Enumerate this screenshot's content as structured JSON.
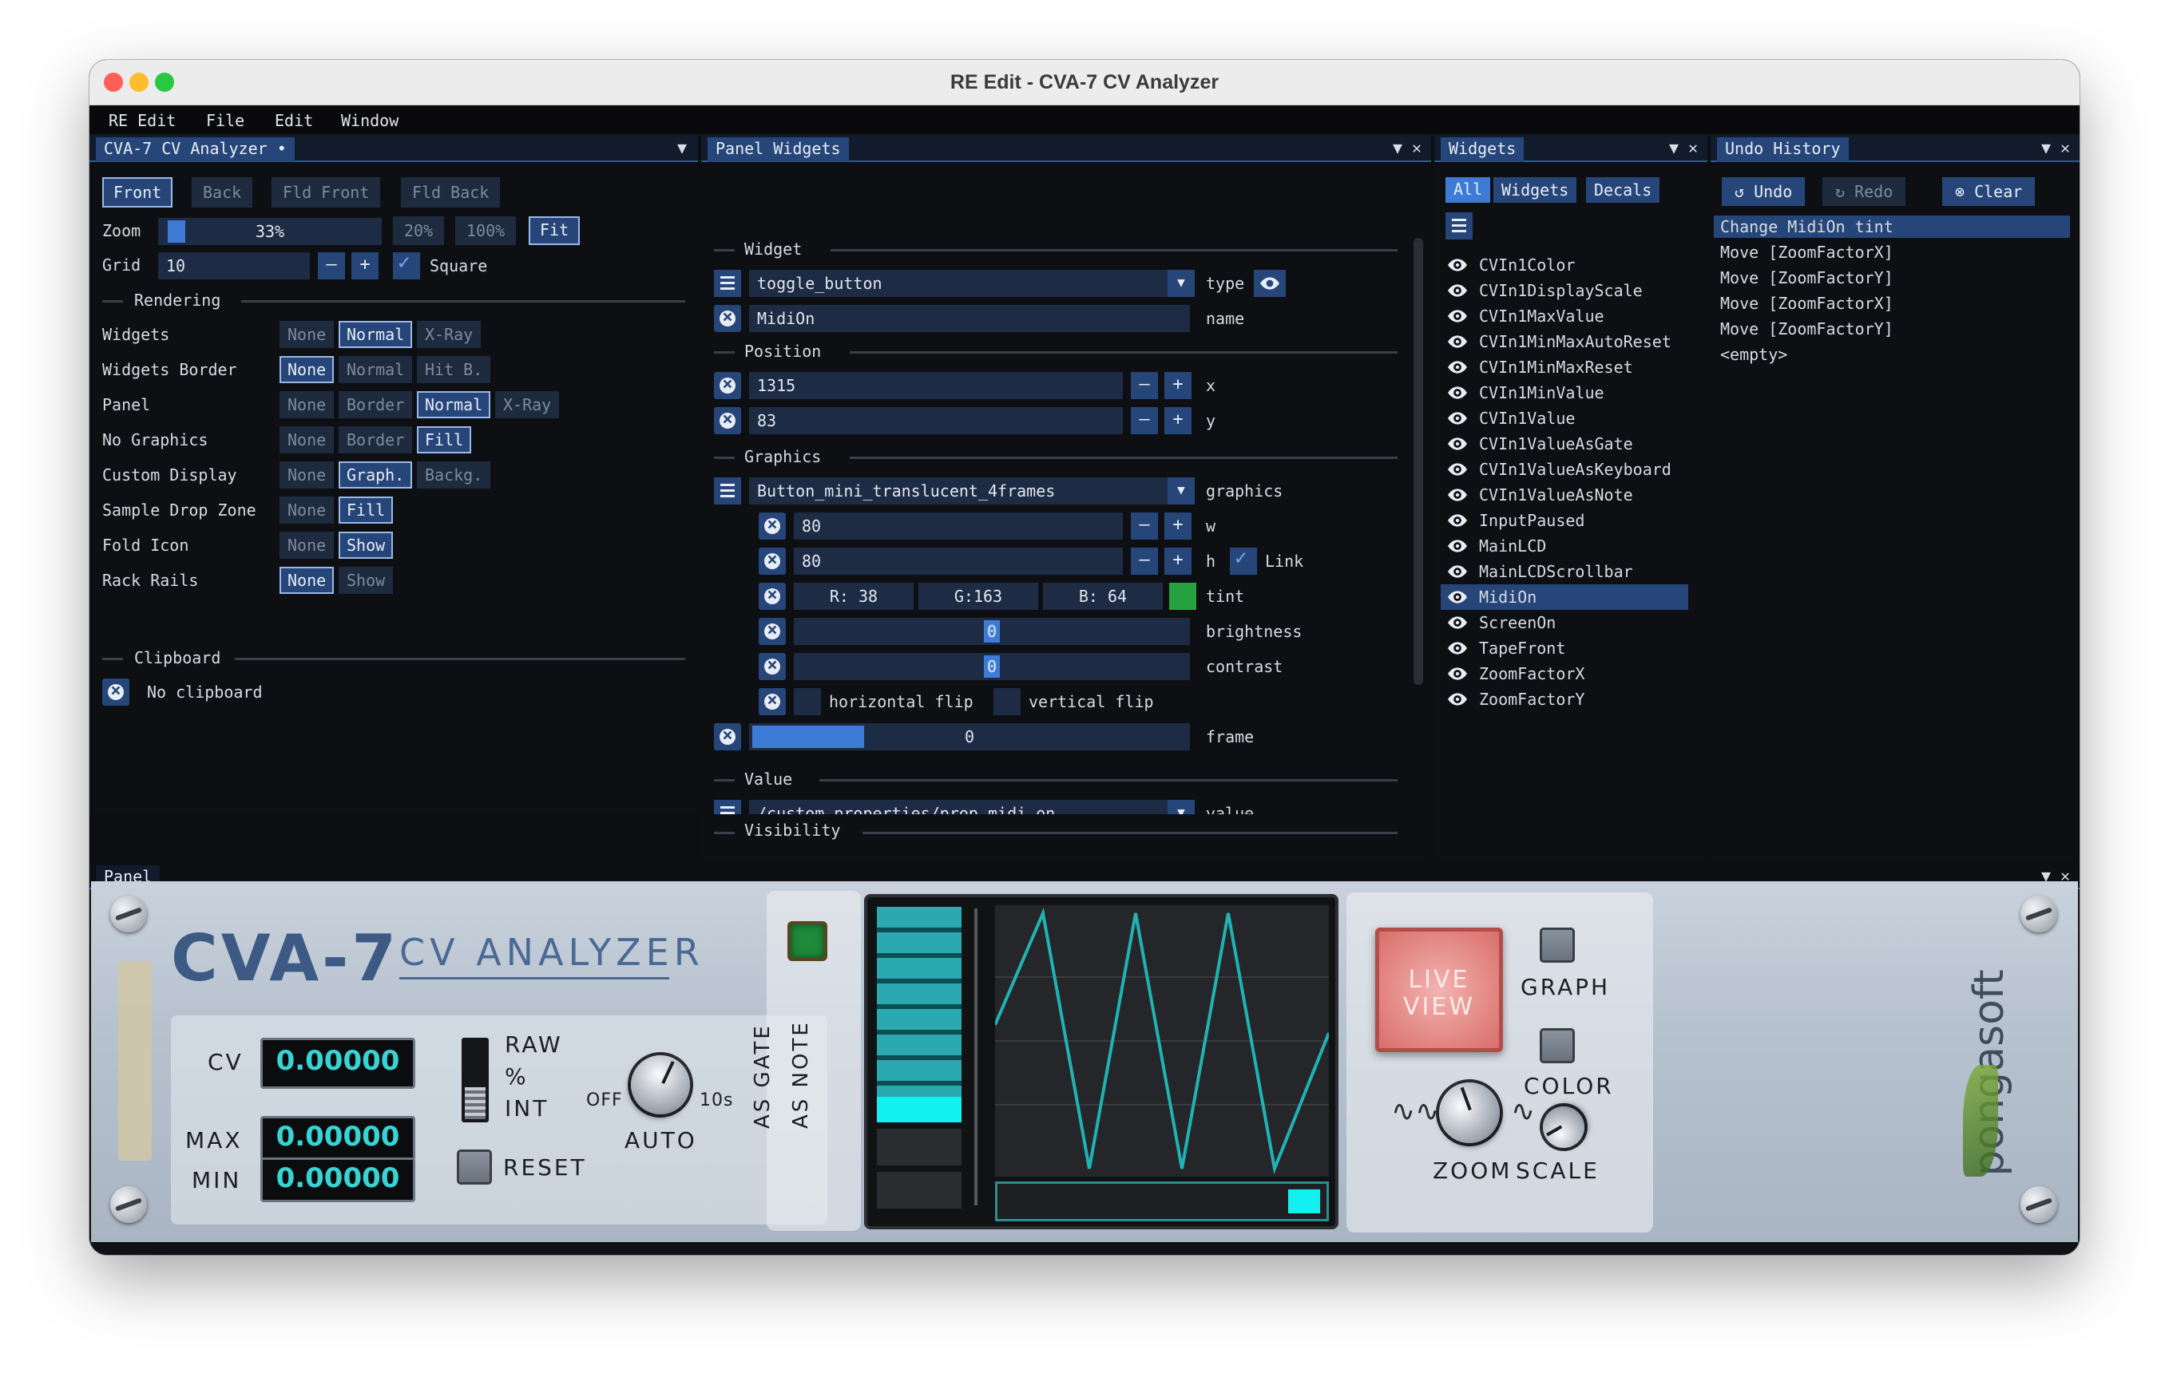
{
  "window": {
    "title": "RE Edit - CVA-7 CV Analyzer"
  },
  "menu": [
    "RE Edit",
    "File",
    "Edit",
    "Window"
  ],
  "left_pane": {
    "tab": "CVA-7 CV Analyzer •",
    "views": [
      "Front",
      "Back",
      "Fld Front",
      "Fld Back"
    ],
    "zoom_label": "Zoom",
    "zoom_value": "33%",
    "zoom_presets": [
      "20%",
      "100%",
      "Fit"
    ],
    "grid_label": "Grid",
    "grid_value": "10",
    "grid_minus": "–",
    "grid_plus": "+",
    "square_label": "Square",
    "rendering_title": "Rendering",
    "rendering_rows": [
      {
        "label": "Widgets",
        "options": [
          "None",
          "Normal",
          "X-Ray"
        ],
        "selected": 1
      },
      {
        "label": "Widgets Border",
        "options": [
          "None",
          "Normal",
          "Hit B."
        ],
        "selected": 0
      },
      {
        "label": "Panel",
        "options": [
          "None",
          "Border",
          "Normal",
          "X-Ray"
        ],
        "selected": 2
      },
      {
        "label": "No Graphics",
        "options": [
          "None",
          "Border",
          "Fill"
        ],
        "selected": 2
      },
      {
        "label": "Custom Display",
        "options": [
          "None",
          "Graph.",
          "Backg."
        ],
        "selected": 1
      },
      {
        "label": "Sample Drop Zone",
        "options": [
          "None",
          "Fill"
        ],
        "selected": 1
      },
      {
        "label": "Fold Icon",
        "options": [
          "None",
          "Show"
        ],
        "selected": 1
      },
      {
        "label": "Rack Rails",
        "options": [
          "None",
          "Show"
        ],
        "selected": 0
      }
    ],
    "clipboard_title": "Clipboard",
    "clipboard_text": "No clipboard"
  },
  "panel_widgets": {
    "tab": "Panel Widgets",
    "widget_title": "Widget",
    "type_value": "toggle_button",
    "type_label": "type",
    "name_value": "MidiOn",
    "name_label": "name",
    "position_title": "Position",
    "x_value": "1315",
    "x_label": "x",
    "y_value": "83",
    "y_label": "y",
    "minus": "–",
    "plus": "+",
    "graphics_title": "Graphics",
    "graphics_value": "Button_mini_translucent_4frames",
    "graphics_label": "graphics",
    "w_value": "80",
    "w_label": "w",
    "h_value": "80",
    "h_label": "h",
    "link_label": "Link",
    "tint_r": "R: 38",
    "tint_g": "G:163",
    "tint_b": "B: 64",
    "tint_color": "#26a340",
    "tint_label": "tint",
    "brightness_value": "0",
    "brightness_label": "brightness",
    "contrast_value": "0",
    "contrast_label": "contrast",
    "hflip_label": "horizontal flip",
    "vflip_label": "vertical flip",
    "frame_value": "0",
    "frame_label": "frame",
    "value_title": "Value",
    "value_path": "/custom_properties/prop_midi_on",
    "value_label": "value",
    "visibility_title": "Visibility"
  },
  "widgets_pane": {
    "tab": "Widgets",
    "filters": [
      "All",
      "Widgets",
      "Decals"
    ],
    "items": [
      "CVIn1Color",
      "CVIn1DisplayScale",
      "CVIn1MaxValue",
      "CVIn1MinMaxAutoReset",
      "CVIn1MinMaxReset",
      "CVIn1MinValue",
      "CVIn1Value",
      "CVIn1ValueAsGate",
      "CVIn1ValueAsKeyboard",
      "CVIn1ValueAsNote",
      "InputPaused",
      "MainLCD",
      "MainLCDScrollbar",
      "MidiOn",
      "ScreenOn",
      "TapeFront",
      "ZoomFactorX",
      "ZoomFactorY"
    ],
    "selected": "MidiOn"
  },
  "undo_pane": {
    "tab": "Undo History",
    "undo": "Undo",
    "redo": "Redo",
    "clear": "Clear",
    "entries": [
      "Change MidiOn tint",
      "Move [ZoomFactorX]",
      "Move [ZoomFactorY]",
      "Move [ZoomFactorX]",
      "Move [ZoomFactorY]",
      "<empty>"
    ]
  },
  "panel_view": {
    "tab": "Panel",
    "device_name": "CVA-7",
    "device_sub": "CV ANALYZER",
    "cv_label": "CV",
    "cv_value": "0.00000",
    "max_label": "MAX",
    "max_value": "0.00000",
    "min_label": "MIN",
    "min_value": "0.00000",
    "raw_label": "RAW",
    "pct_label": "%",
    "int_label": "INT",
    "off_label": "OFF",
    "ten_label": "10s",
    "auto_label": "AUTO",
    "reset_label": "RESET",
    "as_gate_label": "AS GATE",
    "as_note_label": "AS NOTE",
    "live_view_label": "LIVE\nVIEW",
    "graph_label": "GRAPH",
    "color_label": "COLOR",
    "zoom_label": "ZOOM",
    "scale_label": "SCALE",
    "brand": "pongasoft",
    "wave_color": "#1fb3b3"
  }
}
